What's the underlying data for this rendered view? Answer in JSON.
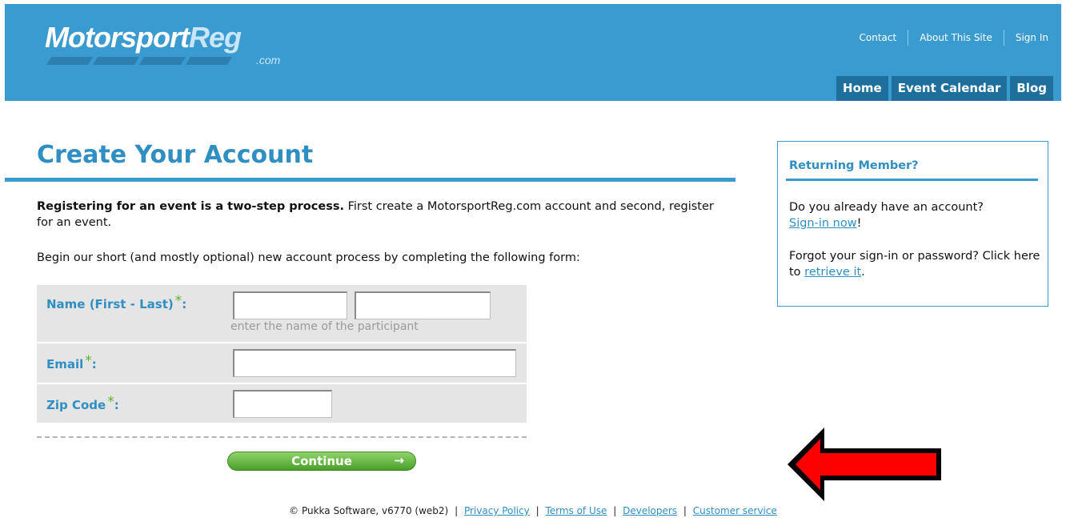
{
  "header": {
    "logo_text_1": "Motorsport",
    "logo_text_2": "Reg",
    "logo_dotcom": ".com",
    "toplinks": [
      "Contact",
      "About This Site",
      "Sign In"
    ],
    "tabs": [
      "Home",
      "Event Calendar",
      "Blog"
    ]
  },
  "main": {
    "title": "Create Your Account",
    "intro_bold": "Registering for an event is a two-step process.",
    "intro_rest": " First create a MotorsportReg.com account and second, register for an event.",
    "intro2": "Begin our short (and mostly optional) new account process by completing the following form:"
  },
  "form": {
    "name_label": "Name (First - Last)",
    "name_hint": "enter the name of the participant",
    "email_label": "Email",
    "zip_label": "Zip Code",
    "required_mark": "*",
    "label_suffix": ":",
    "first_name_value": "",
    "last_name_value": "",
    "email_value": "",
    "zip_value": "",
    "continue_label": "Continue",
    "continue_arrow": "→"
  },
  "sidebar": {
    "title": "Returning Member?",
    "p1_text": "Do you already have an account?",
    "p1_link": "Sign-in now",
    "p1_after": "!",
    "p2_text": "Forgot your sign-in or password? Click here to ",
    "p2_link": "retrieve it",
    "p2_after": "."
  },
  "footer": {
    "copyright": "© Pukka Software, v6770 (web2)",
    "links": [
      "Privacy Policy",
      "Terms of Use",
      "Developers",
      "Customer service"
    ],
    "separator": "|"
  },
  "colors": {
    "header_bg": "#3a9bd0",
    "tab_bg": "#1f6f9c",
    "accent": "#2f8ec2",
    "required_star": "#5ab52a",
    "continue_button": "#5aad32",
    "annotation_arrow": "#ff0000"
  }
}
